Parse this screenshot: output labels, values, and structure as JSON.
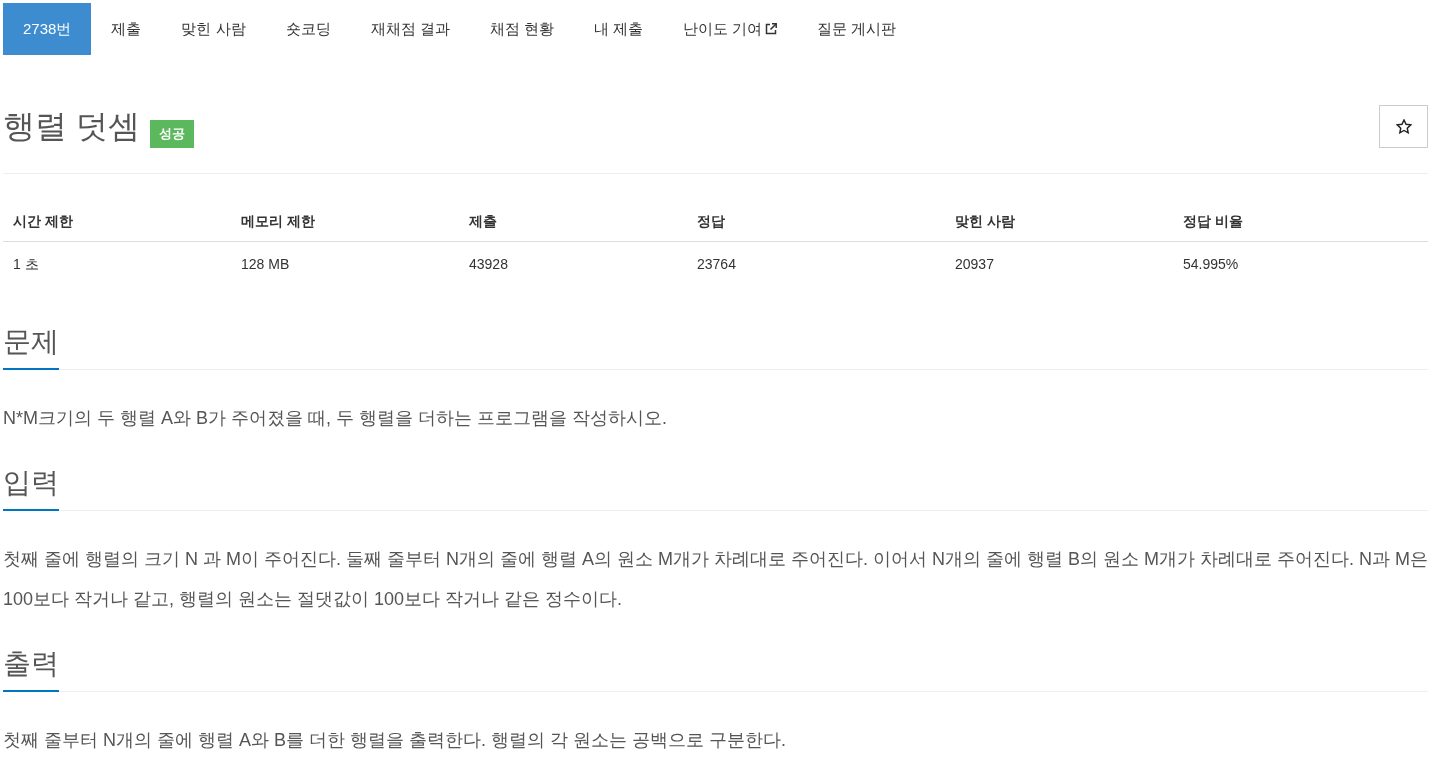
{
  "nav_tabs": [
    {
      "label": "2738번",
      "selected": true,
      "external": false
    },
    {
      "label": "제출",
      "selected": false,
      "external": false
    },
    {
      "label": "맞힌 사람",
      "selected": false,
      "external": false
    },
    {
      "label": "숏코딩",
      "selected": false,
      "external": false
    },
    {
      "label": "재채점 결과",
      "selected": false,
      "external": false
    },
    {
      "label": "채점 현황",
      "selected": false,
      "external": false
    },
    {
      "label": "내 제출",
      "selected": false,
      "external": false
    },
    {
      "label": "난이도 기여",
      "selected": false,
      "external": true
    },
    {
      "label": "질문 게시판",
      "selected": false,
      "external": false
    }
  ],
  "problem": {
    "title": "행렬 덧셈",
    "badge": "성공",
    "starred": false
  },
  "info_table": {
    "columns": [
      "시간 제한",
      "메모리 제한",
      "제출",
      "정답",
      "맞힌 사람",
      "정답 비율"
    ],
    "rows": [
      [
        "1 초",
        "128 MB",
        "43928",
        "23764",
        "20937",
        "54.995%"
      ]
    ]
  },
  "sections": [
    {
      "heading": "문제",
      "paragraphs": [
        "N*M크기의 두 행렬 A와 B가 주어졌을 때, 두 행렬을 더하는 프로그램을 작성하시오."
      ]
    },
    {
      "heading": "입력",
      "paragraphs": [
        "첫째 줄에 행렬의 크기 N 과 M이 주어진다. 둘째 줄부터 N개의 줄에 행렬 A의 원소 M개가 차례대로 주어진다. 이어서 N개의 줄에 행렬 B의 원소 M개가 차례대로 주어진다. N과 M은 100보다 작거나 같고, 행렬의 원소는 절댓값이 100보다 작거나 같은 정수이다."
      ]
    },
    {
      "heading": "출력",
      "paragraphs": [
        "첫째 줄부터 N개의 줄에 행렬 A와 B를 더한 행렬을 출력한다. 행렬의 각 원소는 공백으로 구분한다."
      ]
    }
  ]
}
